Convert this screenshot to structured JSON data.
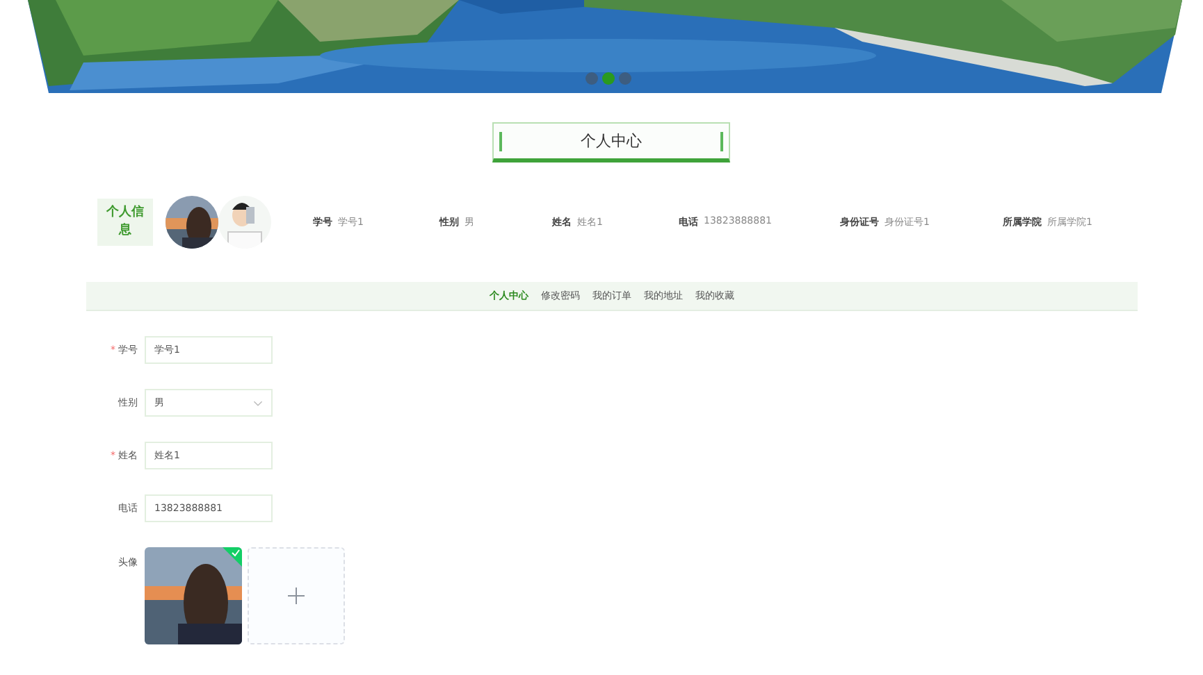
{
  "banner": {
    "dots": [
      {
        "selected": false
      },
      {
        "selected": true
      },
      {
        "selected": false
      }
    ]
  },
  "page_title": "个人中心",
  "profile": {
    "label": "个人信息",
    "fields": [
      {
        "label": "学号",
        "value": "学号1"
      },
      {
        "label": "性别",
        "value": "男"
      },
      {
        "label": "姓名",
        "value": "姓名1"
      },
      {
        "label": "电话",
        "value": "13823888881"
      },
      {
        "label": "身份证号",
        "value": "身份证号1"
      },
      {
        "label": "所属学院",
        "value": "所属学院1"
      }
    ]
  },
  "tabs": [
    {
      "label": "个人中心",
      "selected": true
    },
    {
      "label": "修改密码",
      "selected": false
    },
    {
      "label": "我的订单",
      "selected": false
    },
    {
      "label": "我的地址",
      "selected": false
    },
    {
      "label": "我的收藏",
      "selected": false
    }
  ],
  "form": [
    {
      "kind": "input",
      "required_mark": "*",
      "label": "学号",
      "value": "学号1"
    },
    {
      "kind": "select",
      "label": "性别",
      "value": "男"
    },
    {
      "kind": "input",
      "required_mark": "*",
      "label": "姓名",
      "value": "姓名1"
    },
    {
      "kind": "input",
      "label": "电话",
      "value": "13823888881"
    },
    {
      "kind": "upload",
      "label": "头像",
      "uploaded": true
    }
  ]
}
